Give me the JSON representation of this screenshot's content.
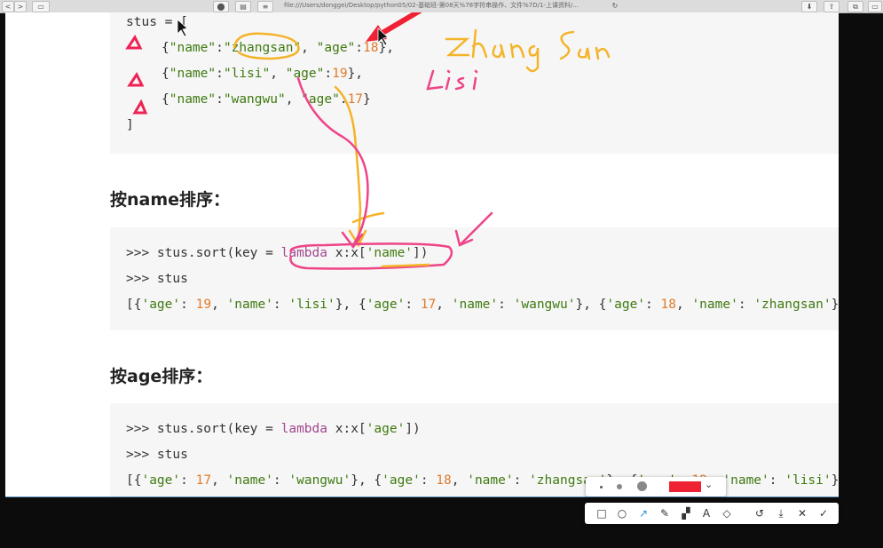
{
  "browser": {
    "url": "file:///Users/donggei/Desktop/python05/02-基础班-第08天%78字符串操作、文件%7D/1-上课资料/...",
    "buttons": [
      "<",
      ">",
      "▭",
      "⬤",
      "▤",
      "≡"
    ]
  },
  "code_blocks": [
    {
      "lines": [
        [
          {
            "t": "stus = ["
          }
        ],
        [
          {
            "t": "{"
          },
          {
            "t": "\"name\"",
            "c": "str"
          },
          {
            "t": ":"
          },
          {
            "t": "\"zhangsan\"",
            "c": "str"
          },
          {
            "t": ", "
          },
          {
            "t": "\"age\"",
            "c": "str"
          },
          {
            "t": ":"
          },
          {
            "t": "18",
            "c": "num"
          },
          {
            "t": "},"
          }
        ],
        [
          {
            "t": "{"
          },
          {
            "t": "\"name\"",
            "c": "str"
          },
          {
            "t": ":"
          },
          {
            "t": "\"lisi\"",
            "c": "str"
          },
          {
            "t": ", "
          },
          {
            "t": "\"age\"",
            "c": "str"
          },
          {
            "t": ":"
          },
          {
            "t": "19",
            "c": "num"
          },
          {
            "t": "},"
          }
        ],
        [
          {
            "t": "{"
          },
          {
            "t": "\"name\"",
            "c": "str"
          },
          {
            "t": ":"
          },
          {
            "t": "\"wangwu\"",
            "c": "str"
          },
          {
            "t": ", "
          },
          {
            "t": "\"age\"",
            "c": "str"
          },
          {
            "t": ":"
          },
          {
            "t": "17",
            "c": "num"
          },
          {
            "t": "}"
          }
        ],
        [
          {
            "t": "]"
          }
        ]
      ]
    },
    {
      "lines": [
        [
          {
            "t": ">>> stus.sort(key = "
          },
          {
            "t": "lambda",
            "c": "kw"
          },
          {
            "t": " x:x["
          },
          {
            "t": "'name'",
            "c": "str"
          },
          {
            "t": "])"
          }
        ],
        [
          {
            "t": ">>> stus"
          }
        ],
        [
          {
            "t": "[{"
          },
          {
            "t": "'age'",
            "c": "str"
          },
          {
            "t": ": "
          },
          {
            "t": "19",
            "c": "num"
          },
          {
            "t": ", "
          },
          {
            "t": "'name'",
            "c": "str"
          },
          {
            "t": ": "
          },
          {
            "t": "'lisi'",
            "c": "str"
          },
          {
            "t": "}, {"
          },
          {
            "t": "'age'",
            "c": "str"
          },
          {
            "t": ": "
          },
          {
            "t": "17",
            "c": "num"
          },
          {
            "t": ", "
          },
          {
            "t": "'name'",
            "c": "str"
          },
          {
            "t": ": "
          },
          {
            "t": "'wangwu'",
            "c": "str"
          },
          {
            "t": "}, {"
          },
          {
            "t": "'age'",
            "c": "str"
          },
          {
            "t": ": "
          },
          {
            "t": "18",
            "c": "num"
          },
          {
            "t": ", "
          },
          {
            "t": "'name'",
            "c": "str"
          },
          {
            "t": ": "
          },
          {
            "t": "'zhangsan'",
            "c": "str"
          },
          {
            "t": "}]"
          }
        ]
      ]
    },
    {
      "lines": [
        [
          {
            "t": ">>> stus.sort(key = "
          },
          {
            "t": "lambda",
            "c": "kw"
          },
          {
            "t": " x:x["
          },
          {
            "t": "'age'",
            "c": "str"
          },
          {
            "t": "])"
          }
        ],
        [
          {
            "t": ">>> stus"
          }
        ],
        [
          {
            "t": "[{"
          },
          {
            "t": "'age'",
            "c": "str"
          },
          {
            "t": ": "
          },
          {
            "t": "17",
            "c": "num"
          },
          {
            "t": ", "
          },
          {
            "t": "'name'",
            "c": "str"
          },
          {
            "t": ": "
          },
          {
            "t": "'wangwu'",
            "c": "str"
          },
          {
            "t": "}, {"
          },
          {
            "t": "'age'",
            "c": "str"
          },
          {
            "t": ": "
          },
          {
            "t": "18",
            "c": "num"
          },
          {
            "t": ", "
          },
          {
            "t": "'name'",
            "c": "str"
          },
          {
            "t": ": "
          },
          {
            "t": "'zhangsan'",
            "c": "str"
          },
          {
            "t": "}, {"
          },
          {
            "t": "'age'",
            "c": "str"
          },
          {
            "t": ": "
          },
          {
            "t": "19",
            "c": "num"
          },
          {
            "t": ", "
          },
          {
            "t": "'name'",
            "c": "str"
          },
          {
            "t": ": "
          },
          {
            "t": "'lisi'",
            "c": "str"
          },
          {
            "t": "}]"
          }
        ]
      ]
    }
  ],
  "headings": {
    "sort_by_name": "按name排序：",
    "sort_by_age": "按age排序："
  },
  "annotations": {
    "handwriting_1": "zhang San",
    "handwriting_2": "Lisi",
    "pen_color": "#ee2233",
    "highlight_color": "#ee4488",
    "marker_color": "#f4b429"
  },
  "colors": {
    "keyword": "#a0488e",
    "string": "#3f7a10",
    "number": "#e07b2a"
  },
  "palette": {
    "sizes": [
      "small-dot",
      "medium-dot",
      "large-dot"
    ],
    "selected_color": "#ee2233"
  },
  "toolbar": {
    "tools": [
      "rectangle-icon",
      "ellipse-icon",
      "arrow-icon",
      "pen-icon",
      "mosaic-icon",
      "text-icon",
      "eraser-icon",
      "undo-icon",
      "download-icon",
      "close-icon",
      "confirm-icon"
    ],
    "glyphs": [
      "□",
      "○",
      "↗",
      "✎",
      "▞",
      "A",
      "◇",
      "↺",
      "⤓",
      "✕",
      "✓"
    ]
  }
}
